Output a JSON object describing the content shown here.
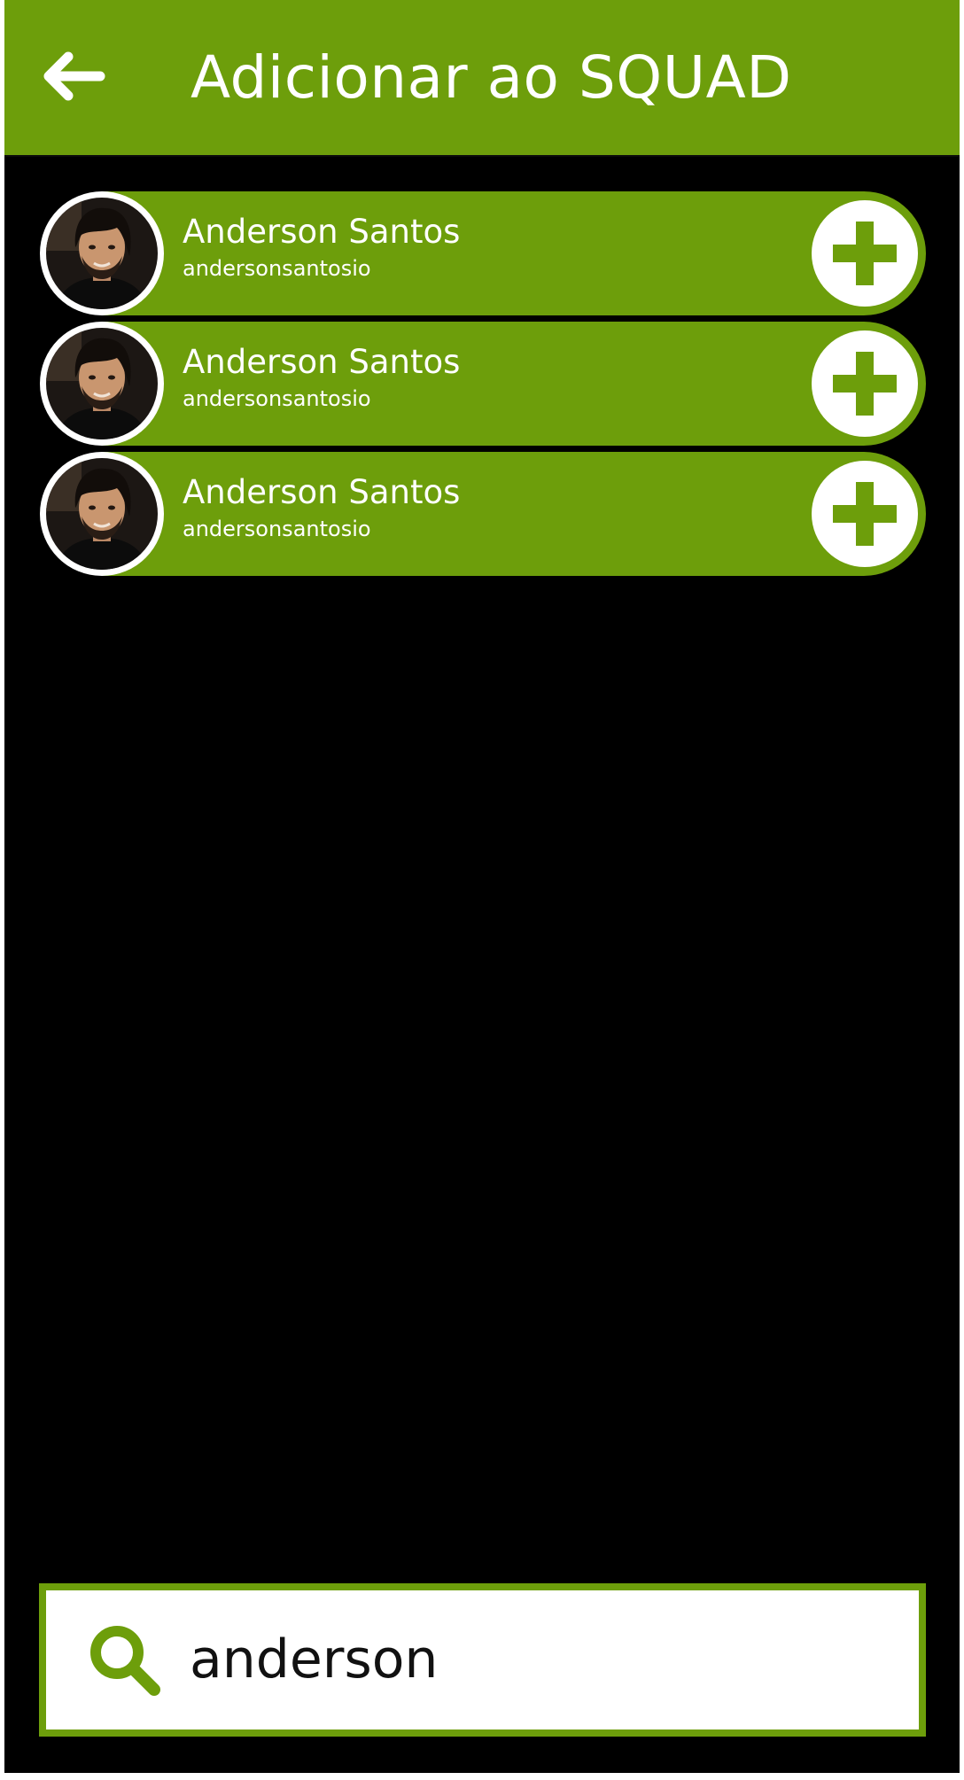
{
  "header": {
    "title": "Adicionar ao SQUAD",
    "back_icon": "arrow-left-icon"
  },
  "results": [
    {
      "name": "Anderson Santos",
      "username": "andersonsantosio",
      "avatar_icon": "profile-photo",
      "action_icon": "plus-icon"
    },
    {
      "name": "Anderson Santos",
      "username": "andersonsantosio",
      "avatar_icon": "profile-photo",
      "action_icon": "plus-icon"
    },
    {
      "name": "Anderson Santos",
      "username": "andersonsantosio",
      "avatar_icon": "profile-photo",
      "action_icon": "plus-icon"
    }
  ],
  "search": {
    "value": "anderson",
    "icon": "search-icon"
  },
  "colors": {
    "accent": "#6d9e0b",
    "background": "#000000",
    "text_light": "#ffffff"
  }
}
